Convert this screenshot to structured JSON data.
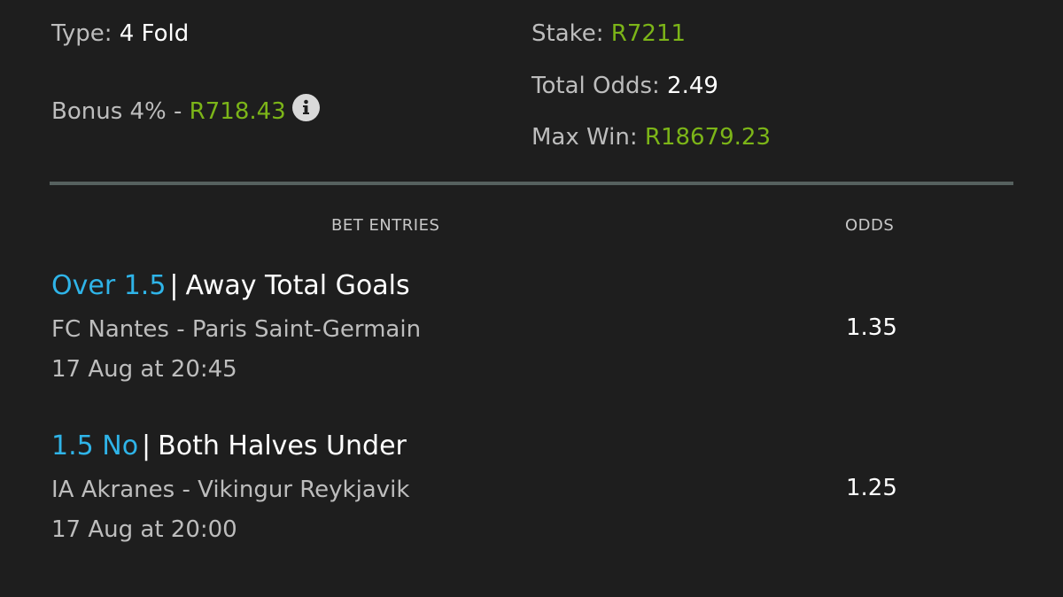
{
  "summary": {
    "type_label": "Type:",
    "type_value": "4 Fold",
    "bonus_label": "Bonus 4% -",
    "bonus_value": "R718.43",
    "stake_label": "Stake:",
    "stake_value": "R7211",
    "total_odds_label": "Total Odds:",
    "total_odds_value": "2.49",
    "max_win_label": "Max Win:",
    "max_win_value": "R18679.23"
  },
  "icons": {
    "info": "info-icon"
  },
  "columns": {
    "entries": "BET ENTRIES",
    "odds": "ODDS"
  },
  "entries": [
    {
      "selection": "Over 1.5",
      "separator": "|",
      "market": "Away Total Goals",
      "match": "FC Nantes - Paris Saint-Germain",
      "date": "17 Aug at 20:45",
      "odds": "1.35"
    },
    {
      "selection": "1.5 No",
      "separator": "|",
      "market": "Both Halves Under",
      "match": "IA Akranes - Vikingur Reykjavik",
      "date": "17 Aug at 20:00",
      "odds": "1.25"
    }
  ],
  "colors": {
    "background": "#1e1e1e",
    "accent_green": "#7cb518",
    "accent_blue": "#2fb4e8",
    "divider": "#56615f"
  }
}
